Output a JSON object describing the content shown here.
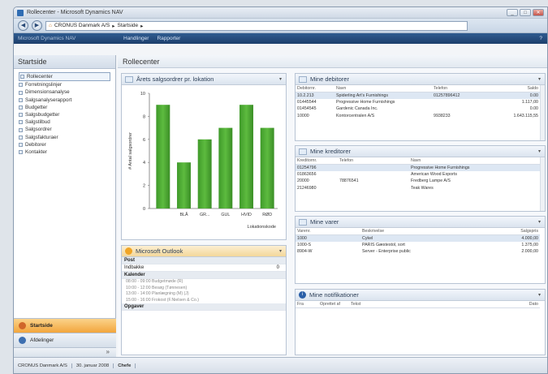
{
  "window": {
    "title": "Rollecenter - Microsoft Dynamics NAV",
    "controls": [
      "_",
      "□",
      "✕"
    ]
  },
  "address": {
    "segments": [
      "CRONUS Danmark A/S",
      "Startside"
    ]
  },
  "command_bar": {
    "nav_title": "Microsoft Dynamics NAV",
    "actions": [
      "Handlinger",
      "Rapporter"
    ],
    "help": "?"
  },
  "nav": {
    "header": "Startside",
    "items": [
      "Rollecenter",
      "Forretningslinjer",
      "Dimensionsanalyse",
      "Salgsanalyserapport",
      "Budgetter",
      "Salgsbudgetter",
      "Salgstilbud",
      "Salgsordrer",
      "Salgsfakturaer",
      "Debitorer",
      "Kontakter"
    ],
    "buttons": [
      "Startside",
      "Afdelinger"
    ],
    "more": "»"
  },
  "main": {
    "title": "Rollecenter",
    "chart_part": {
      "title": "Årets salgsordrer pr. lokation",
      "menu": "▾"
    },
    "debitorer": {
      "title": "Mine debitorer",
      "columns": [
        "Debitornr.",
        "Navn",
        "Telefon",
        "Saldo"
      ],
      "rows": [
        [
          "10.2.213",
          "Spiderling Art's Furnishings",
          "01257896412",
          "0.00"
        ],
        [
          "01445544",
          "Progressive Home Furnishings",
          "",
          "1.117,00"
        ],
        [
          "01454545",
          "Gardenic Canada Inc.",
          "",
          "0.00"
        ],
        [
          "10000",
          "Kontorcentralen A/S",
          "9938233",
          "1.643.115,55"
        ]
      ]
    },
    "kreditorer": {
      "title": "Mine kreditorer",
      "columns": [
        "Kreditornr.",
        "Telefon",
        "Navn"
      ],
      "rows": [
        [
          "01254796",
          "",
          "Progressive Home Furnishings"
        ],
        [
          "01863656",
          "",
          "American Wood Exports"
        ],
        [
          "20000",
          "78876541",
          "Fredberg Lampe A/S"
        ],
        [
          "21246980",
          "",
          "Teak Wares"
        ]
      ]
    },
    "varer": {
      "title": "Mine varer",
      "columns": [
        "Varenr.",
        "Beskrivelse",
        "Salgspris"
      ],
      "rows": [
        [
          "1000",
          "Cykel",
          "4.000,00"
        ],
        [
          "1000-S",
          "PARIS Gæstestol, sort",
          "1.375,00"
        ],
        [
          "8904-W",
          "Server - Enterprise public",
          "2.000,00"
        ]
      ]
    },
    "notifikationer": {
      "title": "Mine notifikationer",
      "columns": [
        "Fra",
        "Oprettet af",
        "Tekst",
        "Dato"
      ]
    },
    "outlook": {
      "title": "Microsoft Outlook",
      "post_header": "Post",
      "inbox_label": "Indbakke",
      "inbox_count": "0",
      "calendar_header": "Kalender",
      "calendar_entries": [
        "08:00 - 09:00  Budgetmøde (R)",
        "10:00 - 12:00  Besøg (Tønnesen)",
        "13:00 - 14:00  Planlægning (M) (J)",
        "15:00 - 16:00  Frokost (F.Nielsen & Co.)"
      ],
      "tasks_header": "Opgaver"
    }
  },
  "status": {
    "company": "CRONUS Danmark A/S",
    "date": "30. januar 2008",
    "user": "Chefe"
  },
  "chart_data": {
    "type": "bar",
    "title": "",
    "categories": [
      "BLÅ",
      "GR...",
      "GUL",
      "HVID",
      "RØD"
    ],
    "values": [
      9,
      4,
      6,
      7,
      9,
      7
    ],
    "x": [
      "",
      "BLÅ",
      "GR...",
      "GUL",
      "HVID",
      "RØD"
    ],
    "ylabel": "# Antal salgsordrer",
    "xlabel": "Lokationskode",
    "ylim": [
      0,
      10
    ],
    "yticks": [
      0,
      2,
      4,
      6,
      8,
      10
    ],
    "color": "#5dbb3f"
  }
}
